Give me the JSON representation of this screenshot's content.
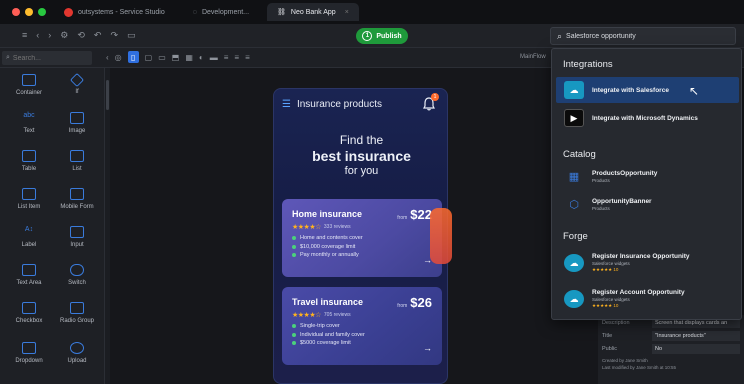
{
  "window": {
    "tabs": [
      {
        "label": "outsystems - Service Studio"
      },
      {
        "label": "Development..."
      },
      {
        "label": "Neo Bank App"
      }
    ],
    "traffic_colors": [
      "#ff5f57",
      "#febc2e",
      "#28c840"
    ]
  },
  "toolbar": {
    "publish_label": "Publish",
    "publish_step": "1",
    "search_value": "Salesforce opportunity"
  },
  "widgets_panel": {
    "search_placeholder": "Search...",
    "items": [
      {
        "label": "Container",
        "icon": "container-icon"
      },
      {
        "label": "If",
        "icon": "if-icon"
      },
      {
        "label": "Text",
        "icon": "text-icon"
      },
      {
        "label": "Image",
        "icon": "image-icon"
      },
      {
        "label": "Table",
        "icon": "table-icon"
      },
      {
        "label": "List",
        "icon": "list-icon"
      },
      {
        "label": "List Item",
        "icon": "list-item-icon"
      },
      {
        "label": "Mobile Form",
        "icon": "mobile-form-icon"
      },
      {
        "label": "Label",
        "icon": "label-icon"
      },
      {
        "label": "Input",
        "icon": "input-icon"
      },
      {
        "label": "Text Area",
        "icon": "text-area-icon"
      },
      {
        "label": "Switch",
        "icon": "switch-icon"
      },
      {
        "label": "Checkbox",
        "icon": "checkbox-icon"
      },
      {
        "label": "Radio Group",
        "icon": "radio-group-icon"
      },
      {
        "label": "Dropdown",
        "icon": "dropdown-icon"
      },
      {
        "label": "Upload",
        "icon": "upload-icon"
      }
    ]
  },
  "canvas": {
    "flow_label": "MainFlow"
  },
  "phone": {
    "header_title": "Insurance products",
    "notification_count": "1",
    "hero_line1": "Find the",
    "hero_line2": "best insurance",
    "hero_line3": "for you",
    "cards": [
      {
        "title": "Home insurance",
        "price_prefix": "from",
        "price": "$22",
        "stars": "★★★★☆",
        "reviews": "333 reviews",
        "features": [
          "Home and contents cover",
          "$10,000 coverage limit",
          "Pay monthly or annually"
        ]
      },
      {
        "title": "Travel insurance",
        "price_prefix": "from",
        "price": "$26",
        "stars": "★★★★☆",
        "reviews": "705 reviews",
        "features": [
          "Single-trip cover",
          "Individual and family cover",
          "$5000 coverage limit"
        ]
      }
    ],
    "accent_color": "#ff6a2b"
  },
  "properties": {
    "rows": [
      {
        "key": "Description",
        "value": "Screen that displays cards an"
      },
      {
        "key": "Title",
        "value": "\"Insurance products\""
      },
      {
        "key": "Public",
        "value": "No"
      }
    ],
    "created_by": "Created by Jane Smith",
    "modified_by": "Last modified by Jane Smith at 10:55"
  },
  "search_results": {
    "sections": [
      {
        "title": "Integrations",
        "items": [
          {
            "title": "Integrate with Salesforce",
            "icon": "salesforce-icon",
            "icon_bg": "#1798c1",
            "highlighted": true
          },
          {
            "title": "Integrate with Microsoft Dynamics",
            "icon": "dynamics-icon",
            "icon_bg": "#0b0b0b",
            "highlighted": false
          }
        ]
      },
      {
        "title": "Catalog",
        "items": [
          {
            "title": "ProductsOpportunity",
            "sub": "Products",
            "icon": "table-grid-icon"
          },
          {
            "title": "OpportunityBanner",
            "sub": "Products",
            "icon": "block-icon"
          }
        ]
      },
      {
        "title": "Forge",
        "items": [
          {
            "title": "Register Insurance Opportunity",
            "sub": "Salesforce widgets",
            "rating": "★★★★★ 10",
            "icon": "forge-salesforce-icon"
          },
          {
            "title": "Register Account Opportunity",
            "sub": "Salesforce widgets",
            "rating": "★★★★★ 10",
            "icon": "forge-salesforce-icon"
          }
        ]
      }
    ]
  }
}
